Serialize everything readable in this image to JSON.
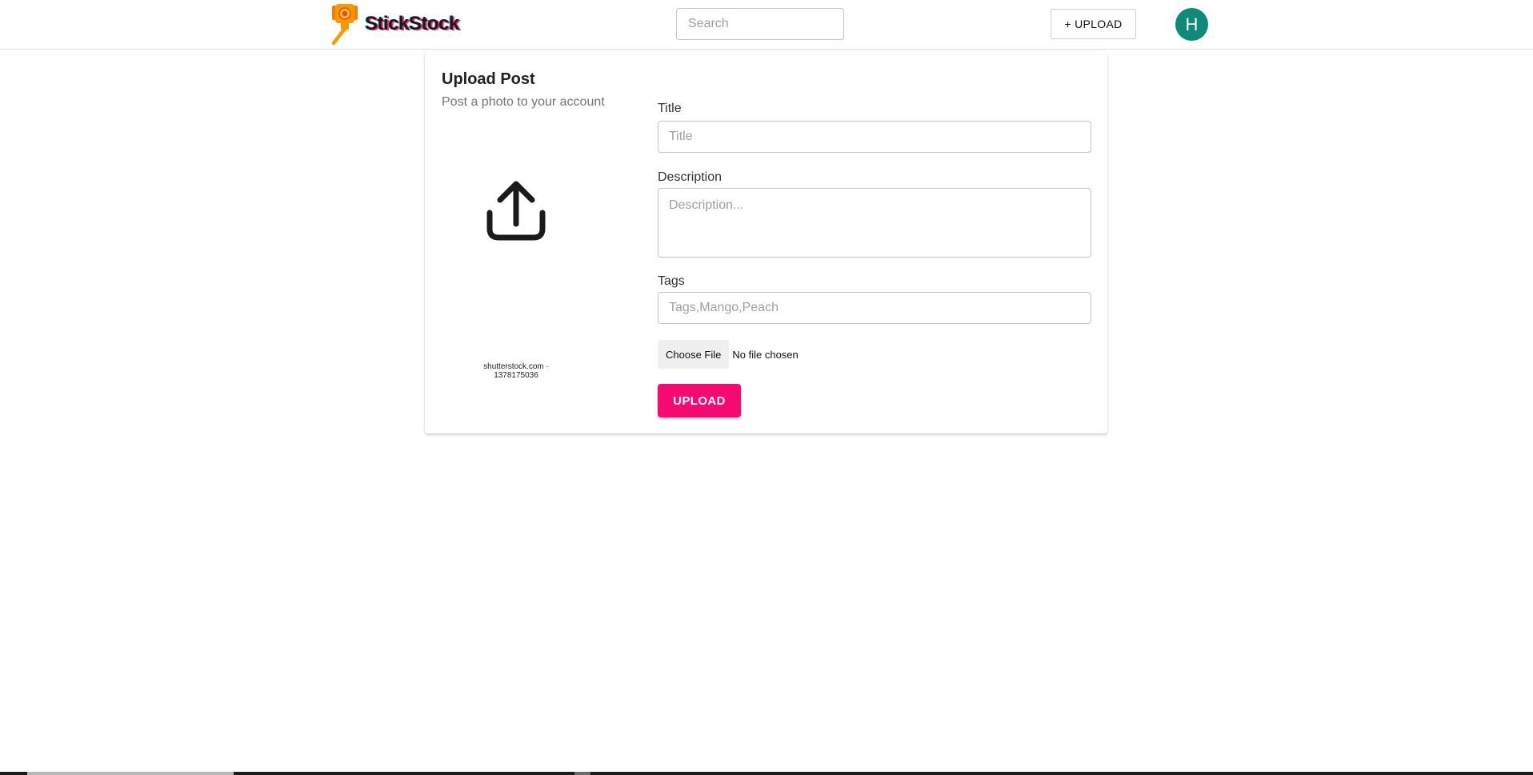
{
  "header": {
    "brand_name": "StickStock",
    "search_placeholder": "Search",
    "upload_label": "+ UPLOAD",
    "avatar_initial": "H",
    "avatar_color": "#0f8a78"
  },
  "form": {
    "title": "Upload Post",
    "subtitle": "Post a photo to your account",
    "preview_watermark": "shutterstock.com · 1378175036",
    "title_label": "Title",
    "title_placeholder": "Title",
    "title_value": "",
    "description_label": "Description",
    "description_placeholder": "Description...",
    "description_value": "",
    "tags_label": "Tags",
    "tags_placeholder": "Tags,Mango,Peach",
    "tags_value": "",
    "choose_file_label": "Choose File",
    "file_status": "No file chosen",
    "submit_label": "UPLOAD",
    "submit_color": "#f50a74"
  },
  "icons": {
    "logo": "selfie-stick-camera-icon",
    "preview": "upload-arrow-icon"
  }
}
